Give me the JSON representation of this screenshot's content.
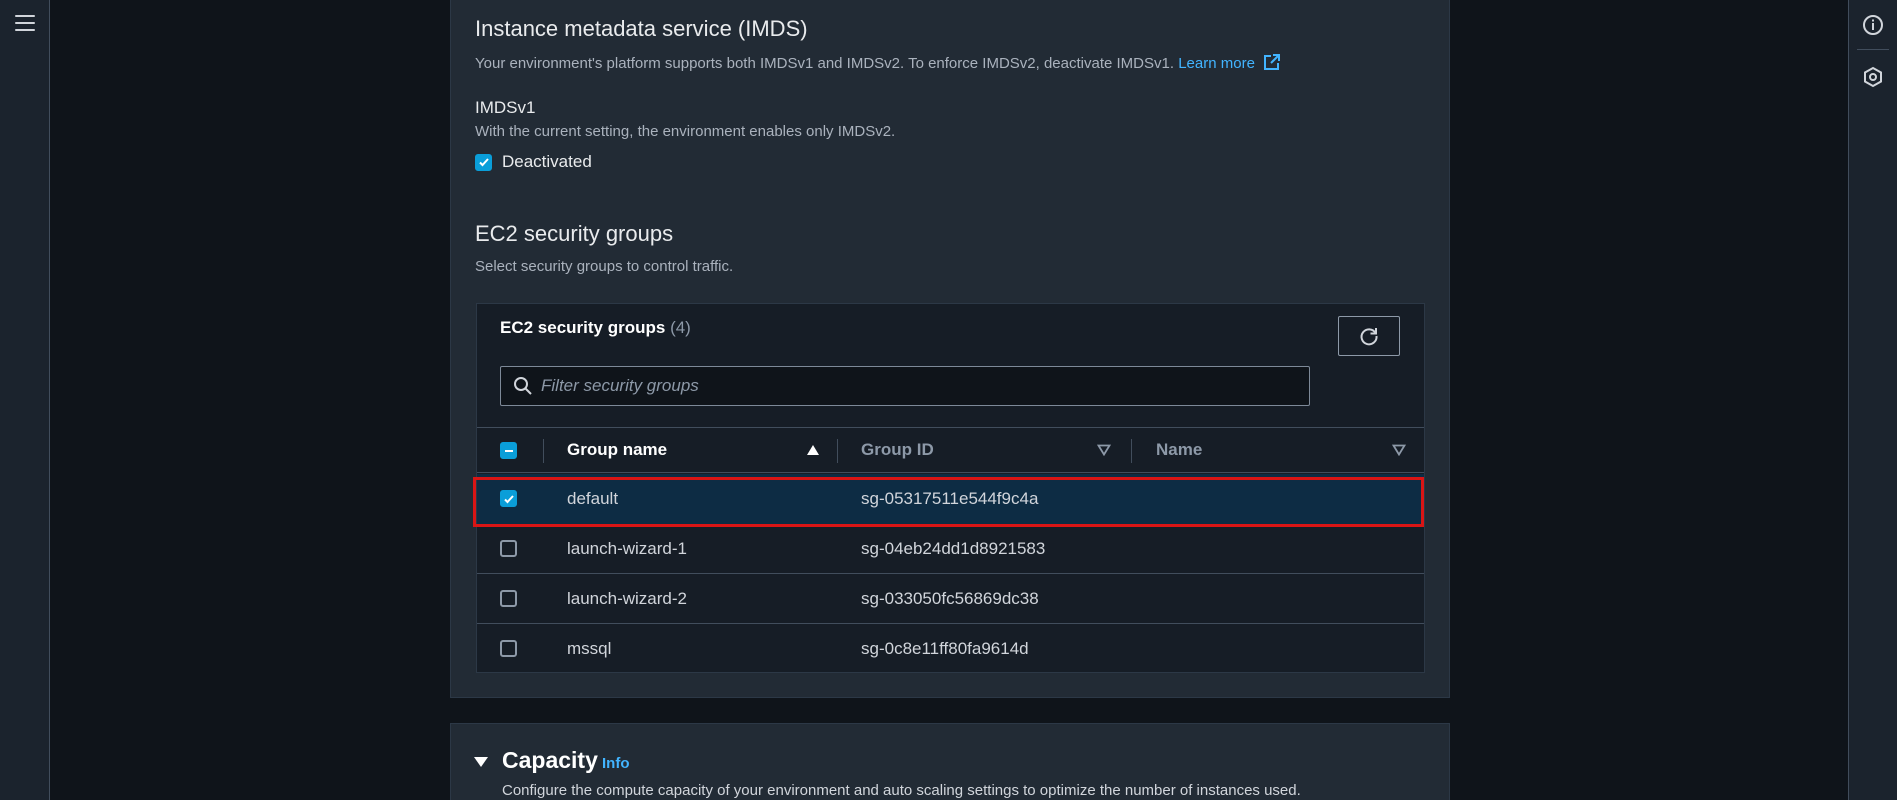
{
  "imds": {
    "heading": "Instance metadata service (IMDS)",
    "description": "Your environment's platform supports both IMDSv1 and IMDSv2. To enforce IMDSv2, deactivate IMDSv1.",
    "learn_more": "Learn more",
    "v1_label": "IMDSv1",
    "v1_desc": "With the current setting, the environment enables only IMDSv2.",
    "deactivated_label": "Deactivated",
    "deactivated_checked": true
  },
  "security_groups": {
    "heading": "EC2 security groups",
    "description": "Select security groups to control traffic.",
    "table_title": "EC2 security groups",
    "count": "(4)",
    "search_placeholder": "Filter security groups",
    "columns": [
      "Group name",
      "Group ID",
      "Name"
    ],
    "rows": [
      {
        "group_name": "default",
        "group_id": "sg-05317511e544f9c4a",
        "name": "",
        "checked": true
      },
      {
        "group_name": "launch-wizard-1",
        "group_id": "sg-04eb24dd1d8921583",
        "name": "",
        "checked": false
      },
      {
        "group_name": "launch-wizard-2",
        "group_id": "sg-033050fc56869dc38",
        "name": "",
        "checked": false
      },
      {
        "group_name": "mssql",
        "group_id": "sg-0c8e11ff80fa9614d",
        "name": "",
        "checked": false
      }
    ]
  },
  "capacity": {
    "heading": "Capacity",
    "info": "Info",
    "description": "Configure the compute capacity of your environment and auto scaling settings to optimize the number of instances used."
  },
  "colors": {
    "accent": "#0a9ed9",
    "link": "#42b4ff",
    "highlight": "#d91515",
    "panel": "#222b35"
  }
}
